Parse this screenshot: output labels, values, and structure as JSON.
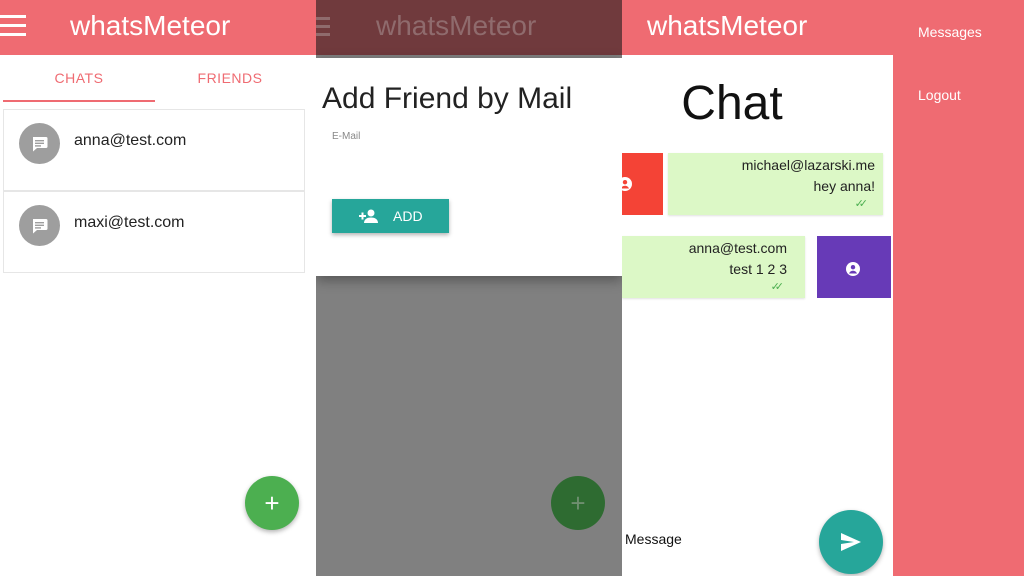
{
  "app": {
    "title": "whatsMeteor",
    "accent_color": "#ef6b72",
    "fab_color": "#4caf50",
    "button_color": "#26a69a"
  },
  "chats_screen": {
    "tabs": [
      {
        "label": "CHATS",
        "active": true
      },
      {
        "label": "FRIENDS",
        "active": false
      }
    ],
    "chats": [
      {
        "name": "anna@test.com",
        "icon": "chat-bubble-icon"
      },
      {
        "name": "maxi@test.com",
        "icon": "chat-bubble-icon"
      }
    ],
    "fab_icon": "plus-icon"
  },
  "dialog": {
    "title": "Add Friend by Mail",
    "field_label": "E-Mail",
    "add_button_label": "ADD",
    "add_button_icon": "person-add-icon"
  },
  "chat_screen": {
    "heading": "Chat",
    "messages": [
      {
        "sender": "michael@lazarski.me",
        "text": "hey anna!",
        "status_icon": "double-check-icon",
        "avatar_color": "#f44336"
      },
      {
        "sender": "anna@test.com",
        "text": "test 1 2 3",
        "status_icon": "double-check-icon",
        "avatar_color": "#673ab7"
      }
    ],
    "input_placeholder": "Message",
    "send_icon": "send-icon"
  },
  "side_menu": {
    "items": [
      {
        "label": "Messages"
      },
      {
        "label": "Logout"
      }
    ]
  }
}
